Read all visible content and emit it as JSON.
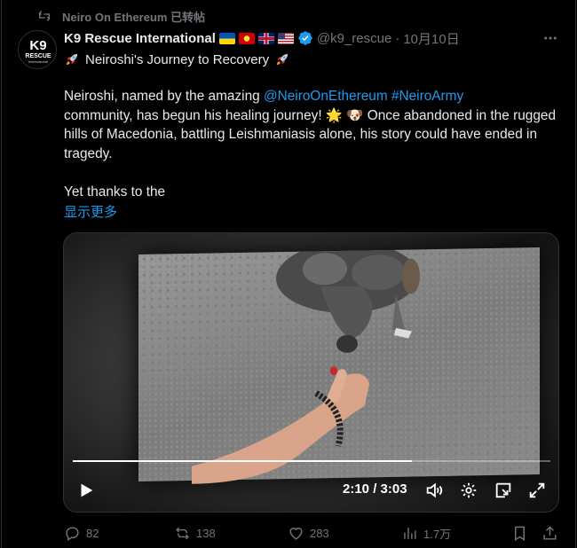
{
  "repost": {
    "text": "Neiro On Ethereum 已转帖"
  },
  "author": {
    "display_name": "K9 Rescue International",
    "avatar_text_top": "K9",
    "avatar_text_mid": "RESCUE",
    "avatar_text_bottom": "International",
    "flags": [
      "ukraine-flag",
      "macedonia-flag",
      "uk-flag",
      "us-flag"
    ],
    "handle": "@k9_rescue",
    "separator": "·",
    "date": "10月10日"
  },
  "post": {
    "title": "Neiroshi's Journey to Recovery",
    "para1_prefix": "Neiroshi, named by the amazing ",
    "mention": "@NeiroOnEthereum",
    "hashtag": "#NeiroArmy",
    "para1_line2": "community, has begun his healing journey! ",
    "emoji_sun": "🌟",
    "emoji_dog": "🐶",
    "para1_rest": " Once abandoned in the rugged hills of Macedonia, battling Leishmaniasis alone, his story could have ended in tragedy.",
    "para2": "Yet thanks to the",
    "show_more": "显示更多"
  },
  "video": {
    "current_time": "2:10",
    "time_separator": " / ",
    "duration": "3:03",
    "progress": 0.71
  },
  "actions": {
    "replies": "82",
    "reposts": "138",
    "likes": "283",
    "views": "1.7万"
  },
  "colors": {
    "accent": "#1d9bf0",
    "muted": "#71767b",
    "text": "#e7e9ea",
    "background": "#000000"
  }
}
